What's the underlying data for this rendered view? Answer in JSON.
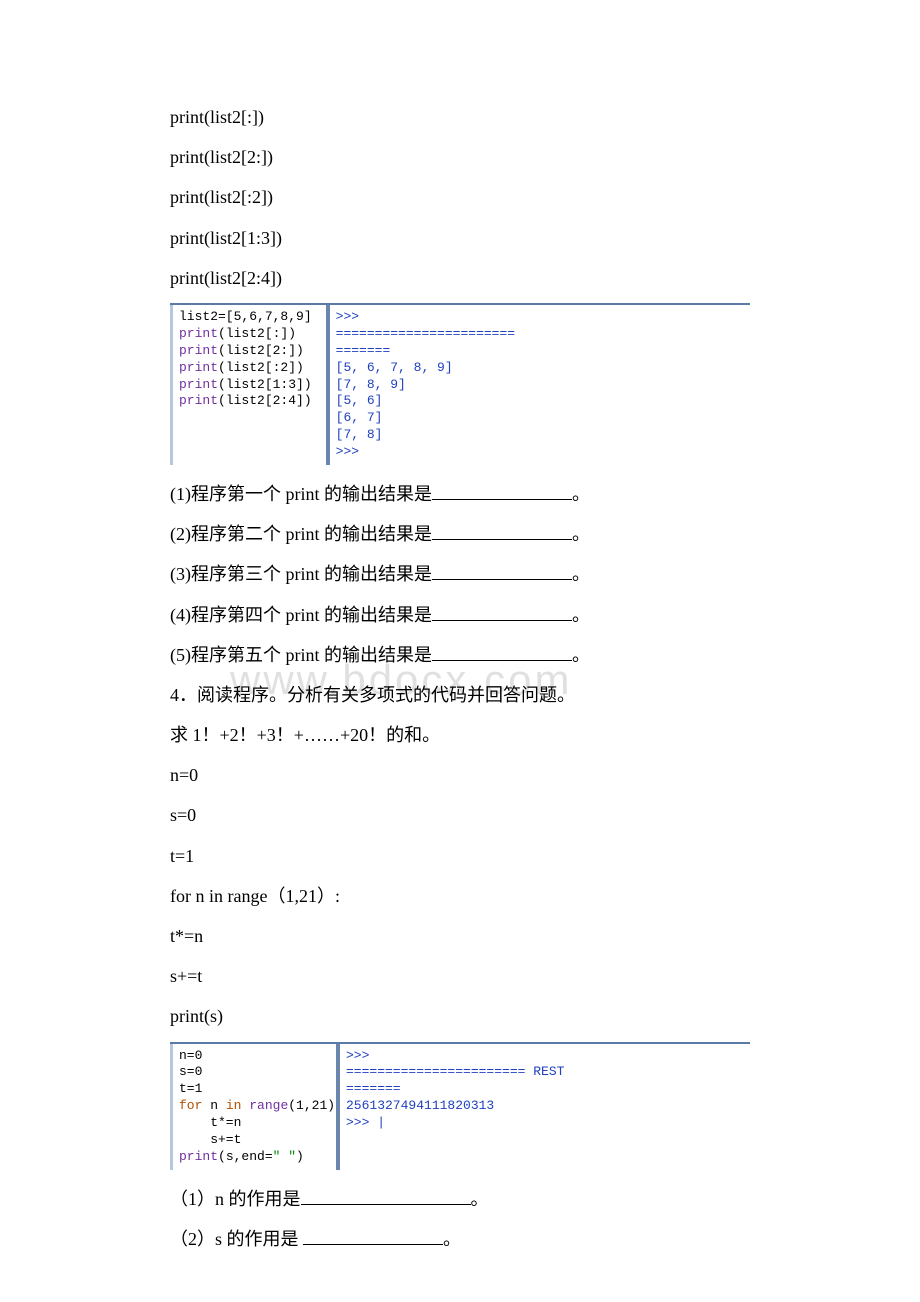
{
  "topCode": {
    "line1": "print(list2[:])",
    "line2": "print(list2[2:])",
    "line3": "print(list2[:2])",
    "line4": "print(list2[1:3])",
    "line5": "print(list2[2:4])"
  },
  "codeBox1": {
    "src_raw": "list2=[5,6,7,8,9]\nprint(list2[:])\nprint(list2[2:])\nprint(list2[:2])\nprint(list2[1:3])\nprint(list2[2:4])",
    "out": ">>>\n=======================\n=======\n[5, 6, 7, 8, 9]\n[7, 8, 9]\n[5, 6]\n[6, 7]\n[7, 8]\n>>>"
  },
  "q1": "(1)程序第一个 print 的输出结果是",
  "q2": "(2)程序第二个 print 的输出结果是",
  "q3": "(3)程序第三个 print 的输出结果是",
  "q4": "(4)程序第四个 print 的输出结果是",
  "q5": "(5)程序第五个 print 的输出结果是",
  "period": "。",
  "sec4": "4．阅读程序。分析有关多项式的代码并回答问题。",
  "sec4desc": "求 1！+2！+3！+……+20！的和。",
  "code2": {
    "l1": "n=0",
    "l2": "s=0",
    "l3": "t=1",
    "l4": "for n in range（1,21）:",
    "l5": "t*=n",
    "l6": "s+=t",
    "l7": "print(s)"
  },
  "codeBox2": {
    "src_raw": "n=0\ns=0\nt=1\nfor n in range(1,21):\n    t*=n\n    s+=t\nprint(s,end=\" \")",
    "out": ">>>\n======================= REST\n=======\n2561327494111820313\n>>> |"
  },
  "q6": "（1）n 的作用是",
  "q7": "（2）s 的作用是 ",
  "watermark": "www.bdocx.com"
}
